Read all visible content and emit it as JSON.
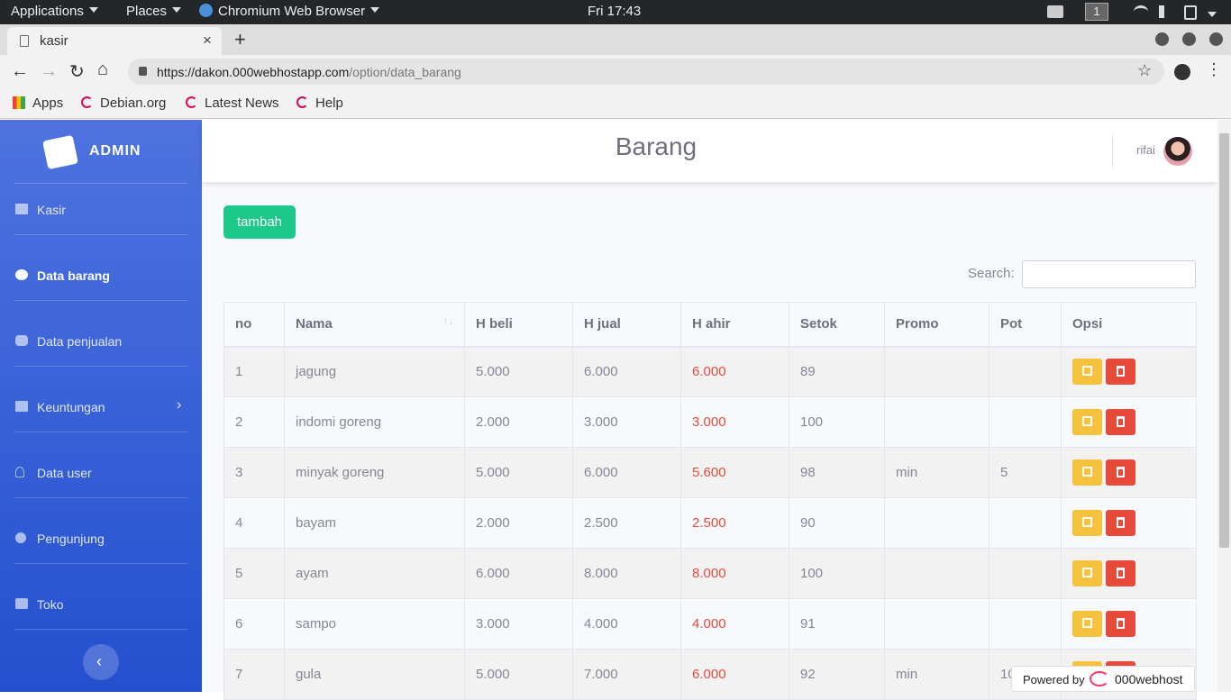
{
  "system_bar": {
    "applications": "Applications",
    "places": "Places",
    "app_name": "Chromium Web Browser",
    "clock": "Fri 17:43",
    "workspace": "1"
  },
  "browser": {
    "tab_title": "kasir",
    "url_host": "https://dakon.000webhostapp.com",
    "url_path": "/option/data_barang",
    "bookmarks": [
      "Apps",
      "Debian.org",
      "Latest News",
      "Help"
    ]
  },
  "sidebar": {
    "brand": "ADMIN",
    "items": [
      {
        "label": "Kasir",
        "icon": "cash-register-icon"
      },
      {
        "label": "Data barang",
        "icon": "boxes-icon"
      },
      {
        "label": "Data penjualan",
        "icon": "handshake-icon"
      },
      {
        "label": "Keuntungan",
        "icon": "money-bill-icon"
      },
      {
        "label": "Data user",
        "icon": "user-icon"
      },
      {
        "label": "Pengunjung",
        "icon": "globe-icon"
      },
      {
        "label": "Toko",
        "icon": "store-icon"
      }
    ]
  },
  "header": {
    "title": "Barang",
    "username": "rifai"
  },
  "content": {
    "add_button": "tambah",
    "search_label": "Search:",
    "search_value": ""
  },
  "table": {
    "columns": [
      "no",
      "Nama",
      "H beli",
      "H jual",
      "H ahir",
      "Setok",
      "Promo",
      "Pot",
      "Opsi"
    ],
    "rows": [
      [
        "1",
        "jagung",
        "5.000",
        "6.000",
        "6.000",
        "89",
        "",
        ""
      ],
      [
        "2",
        "indomi goreng",
        "2.000",
        "3.000",
        "3.000",
        "100",
        "",
        ""
      ],
      [
        "3",
        "minyak goreng",
        "5.000",
        "6.000",
        "5.600",
        "98",
        "min",
        "5"
      ],
      [
        "4",
        "bayam",
        "2.000",
        "2.500",
        "2.500",
        "90",
        "",
        ""
      ],
      [
        "5",
        "ayam",
        "6.000",
        "8.000",
        "8.000",
        "100",
        "",
        ""
      ],
      [
        "6",
        "sampo",
        "3.000",
        "4.000",
        "4.000",
        "91",
        "",
        ""
      ],
      [
        "7",
        "gula",
        "5.000",
        "7.000",
        "6.000",
        "92",
        "min",
        "10"
      ]
    ]
  },
  "footer_badge": {
    "powered": "Powered by",
    "brand": "000webhost"
  },
  "colors": {
    "sidebar": "#4e73df",
    "add": "#1cc88a",
    "edit": "#f6c23e",
    "delete": "#e74a3b",
    "price_final": "#e74a3b"
  }
}
